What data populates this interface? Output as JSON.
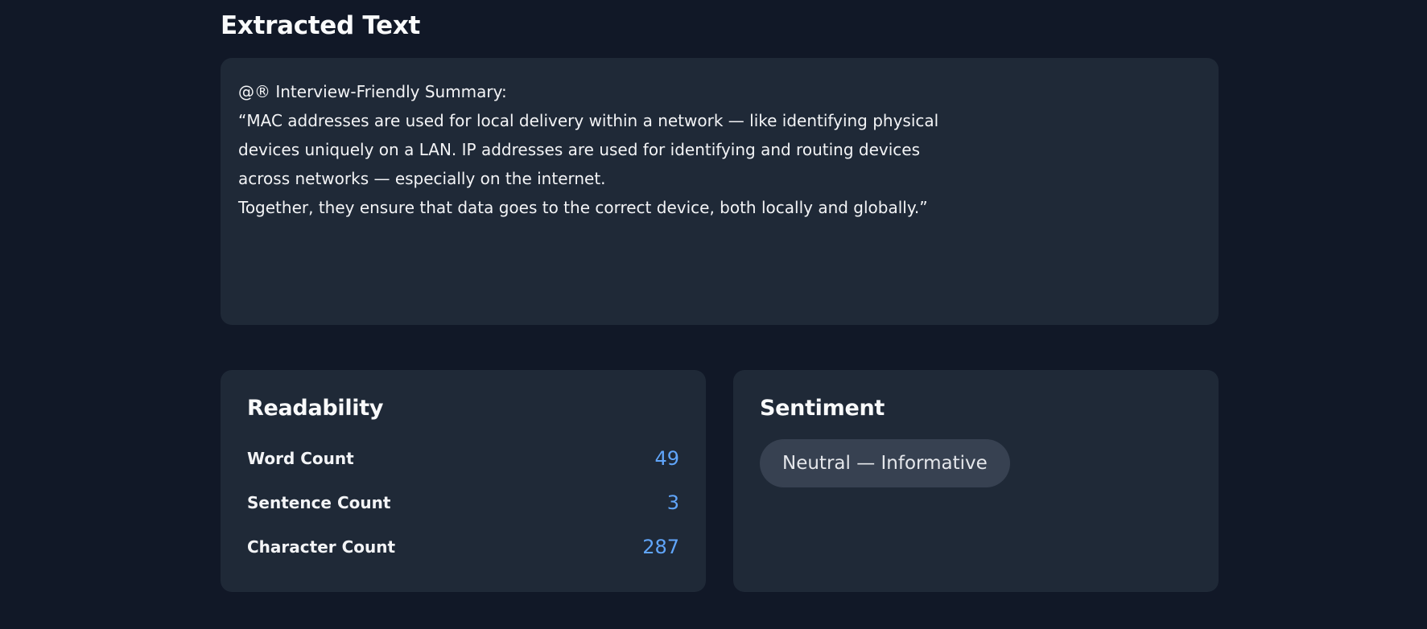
{
  "extracted": {
    "title": "Extracted Text",
    "lines": [
      "@® Interview-Friendly Summary:",
      "“MAC addresses are used for local delivery within a network — like identifying physical",
      "devices uniquely on a LAN. IP addresses are used for identifying and routing devices",
      "across networks — especially on the internet.",
      "Together, they ensure that data goes to the correct device, both locally and globally.”"
    ]
  },
  "readability": {
    "title": "Readability",
    "stats": [
      {
        "label": "Word Count",
        "value": "49"
      },
      {
        "label": "Sentence Count",
        "value": "3"
      },
      {
        "label": "Character Count",
        "value": "287"
      }
    ]
  },
  "sentiment": {
    "title": "Sentiment",
    "value": "Neutral — Informative"
  },
  "colors": {
    "background": "#111827",
    "panel": "#1f2937",
    "accent": "#60a5fa",
    "pill": "#374151"
  }
}
